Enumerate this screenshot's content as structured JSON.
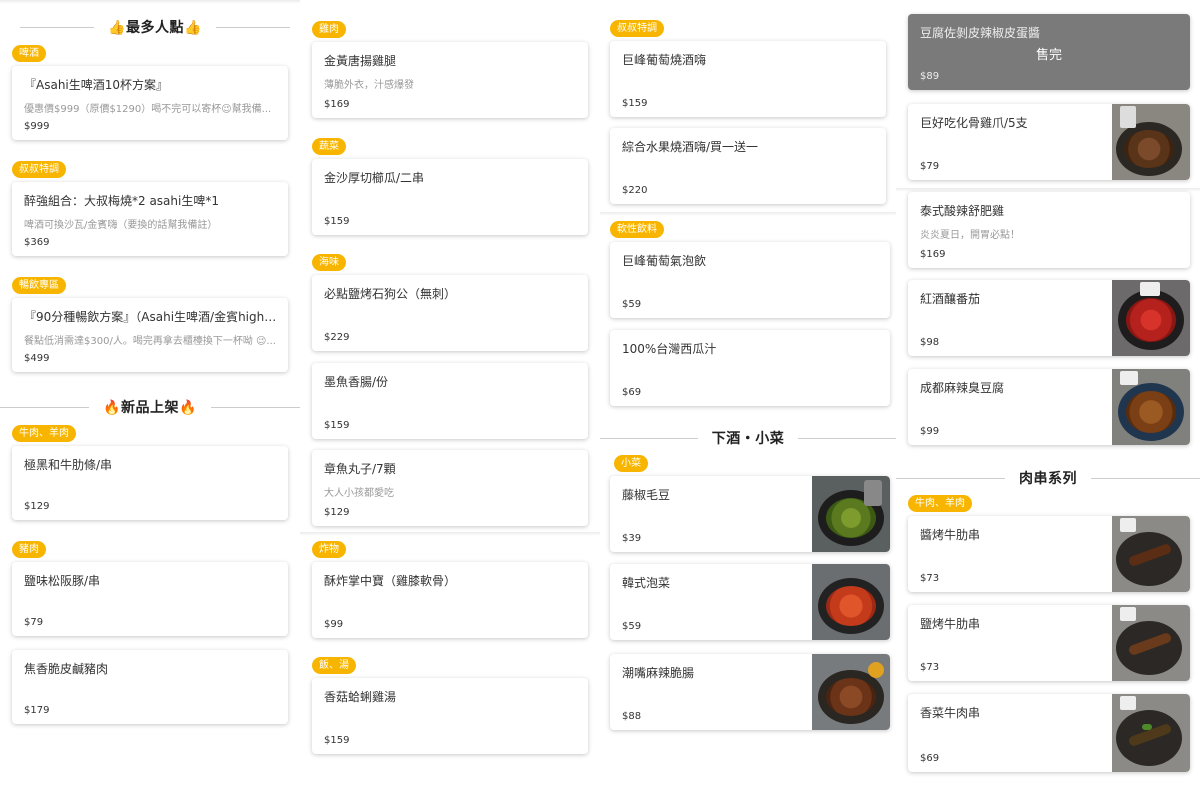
{
  "sections": {
    "popular": "👍最多人點👍",
    "new": "🔥新品上架🔥",
    "snacks": "下酒・小菜",
    "skewers": "肉串系列"
  },
  "tags": {
    "beer": "啤酒",
    "uncle1": "叔叔特調",
    "unlimited": "暢飲專區",
    "beef1": "牛肉、羊肉",
    "pork": "豬肉",
    "chicken": "雞肉",
    "veg": "蔬菜",
    "seafood": "海味",
    "fried": "炸物",
    "rice": "飯、湯",
    "uncle2": "叔叔特調",
    "soft": "軟性飲料",
    "side": "小菜",
    "beef2": "牛肉、羊肉"
  },
  "items": {
    "c1_1": {
      "name": "『Asahi生啤酒10杯方案』",
      "desc": "優惠價$999（原價$1290）喝不完可以寄杯😉幫我備...",
      "price": "$999"
    },
    "c1_2": {
      "name": "醉強組合：大叔梅燒*2 asahi生啤*1",
      "desc": "啤酒可換沙瓦/金賓嗨（要換的話幫我備註）",
      "price": "$369"
    },
    "c1_3": {
      "name": "『90分種暢飲方案』（Asahi生啤酒/金賓high b...",
      "desc": "餐點低消需達$300/人。喝完再拿去櫃檯換下一杯呦 😉...",
      "price": "$499"
    },
    "c1_4": {
      "name": "極黑和牛肋條/串",
      "price": "$129"
    },
    "c1_5": {
      "name": "鹽味松阪豚/串",
      "price": "$79"
    },
    "c1_6": {
      "name": "焦香脆皮鹹豬肉",
      "price": "$179"
    },
    "c2_1": {
      "name": "金黃唐揚雞腿",
      "desc": "薄脆外衣，汁感爆發",
      "price": "$169"
    },
    "c2_2": {
      "name": "金沙厚切櫛瓜/二串",
      "price": "$159"
    },
    "c2_3": {
      "name": "必點鹽烤石狗公（無刺）",
      "price": "$229"
    },
    "c2_4": {
      "name": "墨魚香腸/份",
      "price": "$159"
    },
    "c2_5": {
      "name": "章魚丸子/7顆",
      "desc": "大人小孩都愛吃",
      "price": "$129"
    },
    "c2_6": {
      "name": "酥炸掌中寶（雞膝軟骨）",
      "price": "$99"
    },
    "c2_7": {
      "name": "香菇蛤蜊雞湯",
      "price": "$159"
    },
    "c3_1": {
      "name": "巨峰葡萄燒酒嗨",
      "price": "$159"
    },
    "c3_2": {
      "name": "綜合水果燒酒嗨/買一送一",
      "price": "$220"
    },
    "c3_3": {
      "name": "巨峰葡萄氣泡飲",
      "price": "$59"
    },
    "c3_4": {
      "name": "100%台灣西瓜汁",
      "price": "$69"
    },
    "c3_5": {
      "name": "藤椒毛豆",
      "price": "$39"
    },
    "c3_6": {
      "name": "韓式泡菜",
      "price": "$59"
    },
    "c3_7": {
      "name": "潮嘴麻辣脆腸",
      "price": "$88"
    },
    "c4_1": {
      "name": "豆腐佐剝皮辣椒皮蛋醬",
      "price": "$89",
      "soldout": "售完"
    },
    "c4_2": {
      "name": "巨好吃化骨雞爪/5支",
      "price": "$79"
    },
    "c4_3": {
      "name": "泰式酸辣舒肥雞",
      "desc": "炎炎夏日，開胃必點！",
      "price": "$169"
    },
    "c4_4": {
      "name": "紅酒釀番茄",
      "price": "$98"
    },
    "c4_5": {
      "name": "成都麻辣臭豆腐",
      "price": "$99"
    },
    "c4_6": {
      "name": "醬烤牛肋串",
      "price": "$73"
    },
    "c4_7": {
      "name": "鹽烤牛肋串",
      "price": "$73"
    },
    "c4_8": {
      "name": "香菜牛肉串",
      "price": "$69"
    }
  },
  "icons": {
    "food_photo": "food-photo-icon"
  },
  "colors": {
    "tag": "#f8b500",
    "soldout_bg": "#7a7a7a"
  }
}
